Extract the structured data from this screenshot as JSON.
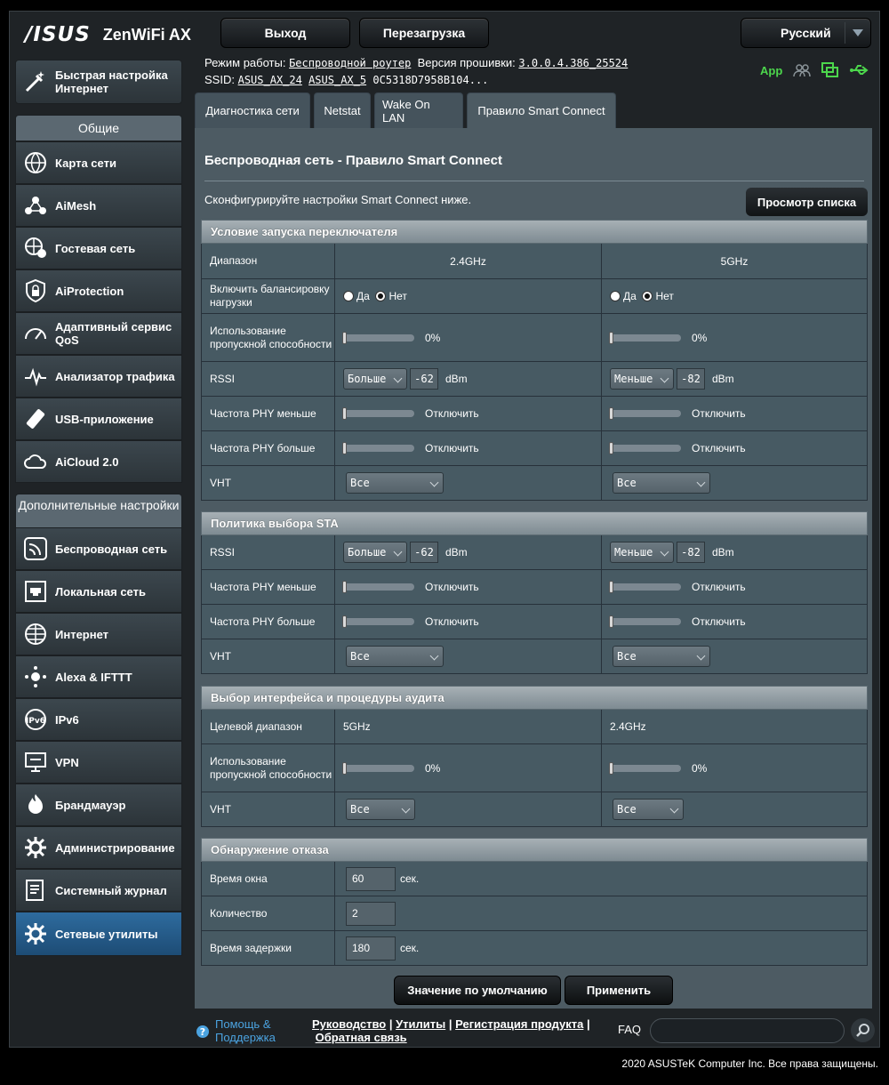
{
  "header": {
    "brand": "/ISUS",
    "model": "ZenWiFi AX",
    "logout": "Выход",
    "reboot": "Перезагрузка",
    "language": "Русский"
  },
  "status": {
    "mode_label": "Режим работы:",
    "mode_value": "Беспроводной роутер",
    "fw_label": "Версия прошивки:",
    "fw_value": "3.0.0.4.386_25524",
    "ssid_label": "SSID:",
    "ssid1": "ASUS_AX_24",
    "ssid2": "ASUS_AX_5",
    "mac": "0C5318D7958B104...",
    "app": "App"
  },
  "tabs": [
    "Диагностика сети",
    "Netstat",
    "Wake On LAN",
    "Правило Smart Connect"
  ],
  "sidebar": {
    "quick": "Быстрая настройка Интернет",
    "general_head": "Общие",
    "general": [
      "Карта сети",
      "AiMesh",
      "Гостевая сеть",
      "AiProtection",
      "Адаптивный сервис QoS",
      "Анализатор трафика",
      "USB-приложение",
      "AiCloud 2.0"
    ],
    "adv_head": "Дополнительные настройки",
    "advanced": [
      "Беспроводная сеть",
      "Локальная сеть",
      "Интернет",
      "Alexa & IFTTT",
      "IPv6",
      "VPN",
      "Брандмауэр",
      "Администрирование",
      "Системный журнал",
      "Сетевые утилиты"
    ]
  },
  "page": {
    "title": "Беспроводная сеть - Правило Smart Connect",
    "desc": "Сконфигурируйте настройки Smart Connect ниже.",
    "view_list": "Просмотр списка"
  },
  "sec1": {
    "head": "Условие запуска переключателя",
    "band_label": "Диапазон",
    "band1": "2.4GHz",
    "band2": "5GHz",
    "lb_label": "Включить балансировку нагрузки",
    "yes": "Да",
    "no": "Нет",
    "bw_label": "Использование пропускной способности",
    "bw1": "0%",
    "bw2": "0%",
    "rssi_label": "RSSI",
    "rssi1_op": "Больше",
    "rssi1_val": "-62",
    "rssi2_op": "Меньше",
    "rssi2_val": "-82",
    "dbm": "dBm",
    "phy_lt_label": "Частота PHY меньше",
    "phy_gt_label": "Частота PHY больше",
    "off": "Отключить",
    "vht_label": "VHT",
    "vht": "Все"
  },
  "sec2": {
    "head": "Политика выбора STA",
    "rssi_label": "RSSI",
    "rssi1_op": "Больше",
    "rssi1_val": "-62",
    "rssi2_op": "Меньше",
    "rssi2_val": "-82",
    "dbm": "dBm",
    "phy_lt_label": "Частота PHY меньше",
    "phy_gt_label": "Частота PHY больше",
    "off": "Отключить",
    "vht_label": "VHT",
    "vht": "Все"
  },
  "sec3": {
    "head": "Выбор интерфейса и процедуры аудита",
    "target_label": "Целевой диапазон",
    "target1": "5GHz",
    "target2": "2.4GHz",
    "bw_label": "Использование пропускной способности",
    "bw1": "0%",
    "bw2": "0%",
    "vht_label": "VHT",
    "vht": "Все"
  },
  "sec4": {
    "head": "Обнаружение отказа",
    "window_label": "Время окна",
    "window_val": "60",
    "sec": "сек.",
    "count_label": "Количество",
    "count_val": "2",
    "delay_label": "Время задержки",
    "delay_val": "180"
  },
  "buttons": {
    "default": "Значение по умолчанию",
    "apply": "Применить"
  },
  "footer": {
    "help": "Помощь & Поддержка",
    "manual": "Руководство",
    "utils": "Утилиты",
    "reg": "Регистрация продукта",
    "feedback": "Обратная связь",
    "faq": "FAQ",
    "copyright": "2020 ASUSTeK Computer Inc. Все права защищены."
  },
  "colors": {
    "accent": "#2e6b9e",
    "panel": "#4d5b63",
    "app_green": "#4cd64c",
    "help_blue": "#4ba3e0"
  }
}
